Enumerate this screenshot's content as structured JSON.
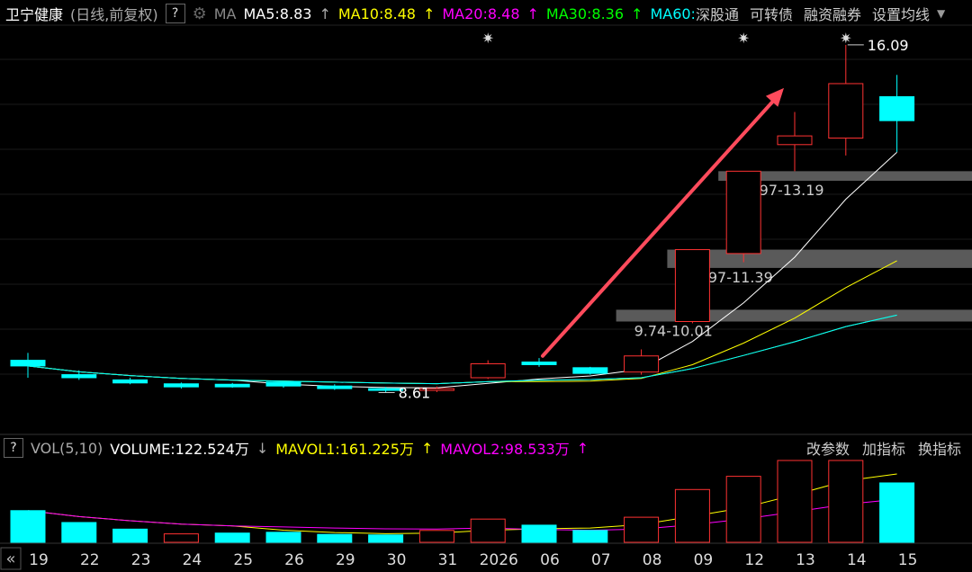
{
  "header": {
    "title": "卫宁健康",
    "subtitle": "(日线,前复权)",
    "help": "?",
    "indicator": "MA",
    "ma5": "MA5:8.83",
    "ma10": "MA10:8.48",
    "ma20": "MA20:8.48",
    "ma30": "MA30:8.36",
    "ma60": "MA60:",
    "links": [
      "深股通",
      "可转债",
      "融资融券",
      "设置均线"
    ],
    "colors": {
      "ma5": "#ffffff",
      "ma10": "#ffff00",
      "ma20": "#ff00ff",
      "ma30": "#00ff00",
      "ma60": "#00ffff"
    }
  },
  "annotations": {
    "high_label": "16.09",
    "low_label": "8.61",
    "zones": [
      "12.97-13.19",
      "10.97-11.39",
      "9.74-10.01"
    ]
  },
  "volume": {
    "help": "?",
    "label": "VOL(5,10)",
    "volume": "VOLUME:122.524万",
    "mavol1": "MAVOL1:161.225万",
    "mavol2": "MAVOL2:98.533万",
    "actions": [
      "改参数",
      "加指标",
      "换指标"
    ]
  },
  "x_axis": {
    "nav_icon": "«",
    "dates": [
      "19",
      "22",
      "23",
      "24",
      "25",
      "26",
      "29",
      "30",
      "31",
      "2026",
      "06",
      "07",
      "08",
      "09",
      "12",
      "13",
      "14",
      "15"
    ]
  },
  "chart_data": {
    "type": "candlestick",
    "categories": [
      "19",
      "22",
      "23",
      "24",
      "25",
      "26",
      "29",
      "30",
      "31",
      "2026",
      "06",
      "07",
      "08",
      "09",
      "12",
      "13",
      "14",
      "15"
    ],
    "ohlc": [
      [
        8.85,
        9.02,
        8.45,
        8.72
      ],
      [
        8.52,
        8.62,
        8.4,
        8.45
      ],
      [
        8.4,
        8.45,
        8.3,
        8.33
      ],
      [
        8.31,
        8.34,
        8.2,
        8.24
      ],
      [
        8.3,
        8.33,
        8.22,
        8.24
      ],
      [
        8.35,
        8.36,
        8.22,
        8.26
      ],
      [
        8.26,
        8.3,
        8.17,
        8.2
      ],
      [
        8.2,
        8.24,
        8.11,
        8.18
      ],
      [
        8.18,
        8.25,
        8.12,
        8.2
      ],
      [
        8.45,
        8.85,
        8.42,
        8.77
      ],
      [
        8.81,
        8.9,
        8.7,
        8.75
      ],
      [
        8.68,
        8.7,
        8.52,
        8.55
      ],
      [
        8.58,
        9.1,
        8.52,
        8.95
      ],
      [
        9.74,
        11.39,
        9.7,
        11.39
      ],
      [
        11.3,
        13.19,
        11.1,
        13.19
      ],
      [
        13.8,
        14.55,
        13.19,
        14.0
      ],
      [
        13.95,
        16.09,
        13.55,
        15.2
      ],
      [
        14.9,
        15.4,
        13.63,
        14.35
      ]
    ],
    "volume": [
      120,
      75,
      50,
      32,
      35,
      38,
      30,
      28,
      45,
      88,
      65,
      45,
      95,
      200,
      250,
      310,
      310,
      225
    ],
    "volume_up": [
      false,
      false,
      false,
      true,
      false,
      false,
      false,
      false,
      true,
      true,
      false,
      false,
      true,
      true,
      true,
      true,
      true,
      false
    ],
    "ylim": [
      7.5,
      16.5
    ],
    "colors": {
      "up": "#ff3232",
      "down": "#00ffff",
      "ma5": "#ffffff",
      "ma10": "#ffff00",
      "ma20": "#ff00ff",
      "ma30": "#00ff00",
      "ma60": "#00ffff",
      "mavol1": "#ffff00",
      "mavol2": "#ff00ff"
    }
  }
}
